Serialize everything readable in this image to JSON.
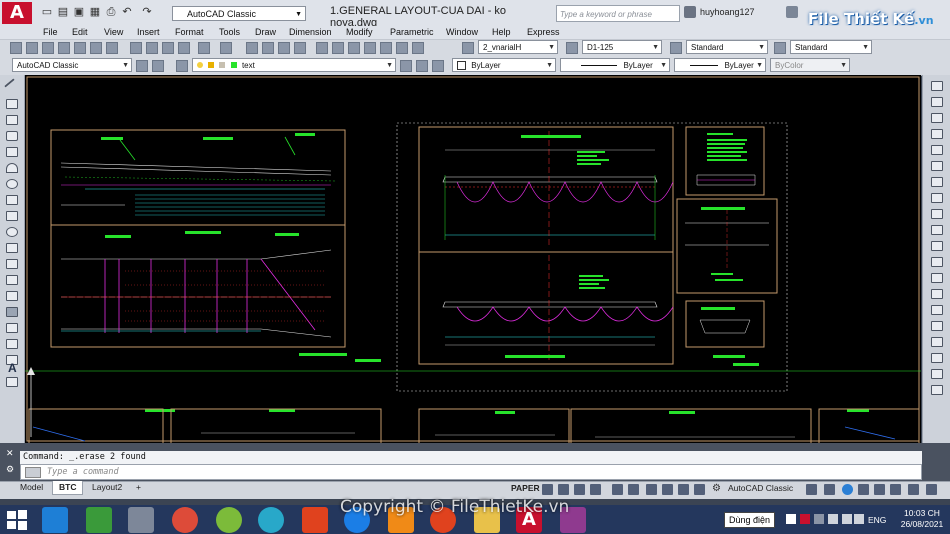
{
  "app": {
    "logo_letter": "A",
    "doc_title": "1.GENERAL LAYOUT-CUA DAI - ko nova.dwg",
    "search_placeholder": "Type a keyword or phrase",
    "user": "huyhoang127",
    "workspace": "AutoCAD Classic",
    "watermark": "File Thiết Kế",
    "watermark_suffix": ".vn"
  },
  "menu": [
    "File",
    "Edit",
    "View",
    "Insert",
    "Format",
    "Tools",
    "Draw",
    "Dimension",
    "Modify",
    "Parametric",
    "Window",
    "Help",
    "Express"
  ],
  "toolbar1": {
    "text_style": "2_vnarialH",
    "dim_style": "D1-125",
    "table_style": "Standard",
    "mleader_style": "Standard"
  },
  "toolbar2": {
    "workspace": "AutoCAD Classic",
    "layer": "text",
    "color": "ByLayer",
    "linetype": "ByLayer",
    "lineweight": "ByLayer",
    "plotstyle": "ByColor"
  },
  "command": {
    "history": "Command: _.erase 2 found",
    "placeholder": "Type a command"
  },
  "layout_tabs": [
    "Model",
    "BTC",
    "Layout2",
    "+"
  ],
  "status": {
    "space": "PAPER",
    "workspace": "AutoCAD Classic"
  },
  "taskbar": {
    "copyright": "Copyright © FileThietKe.vn",
    "power_tooltip": "Dùng điện",
    "lang": "ENG",
    "time": "10:03 CH",
    "date": "26/08/2021"
  },
  "colors": {
    "canvas": "#000000",
    "accent_cad": "#c8102e",
    "sheet_frame": "#c49a6c",
    "green_text": "#27e32b",
    "magenta": "#e22de2",
    "cyan": "#2fe6e6"
  }
}
